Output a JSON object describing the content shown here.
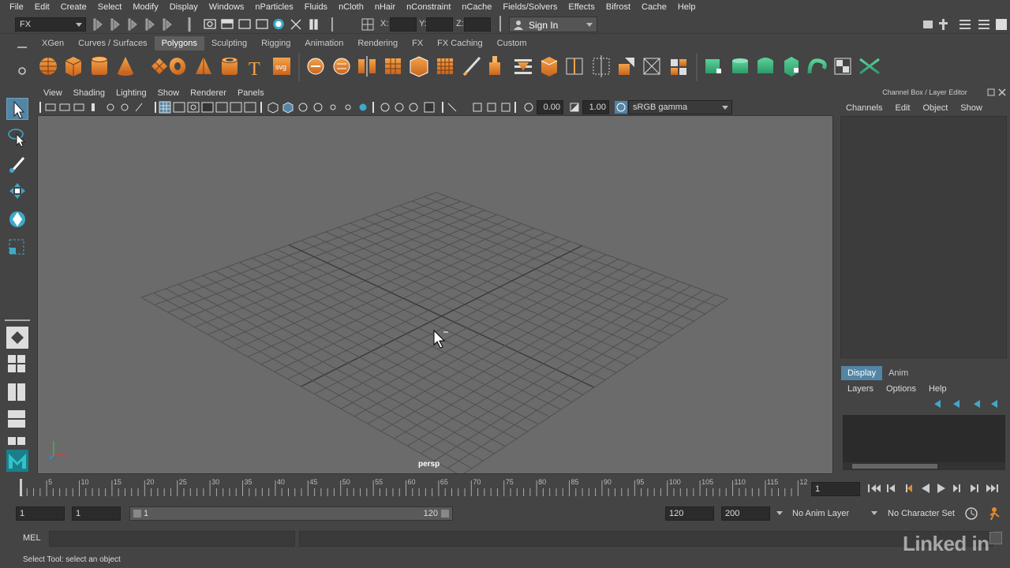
{
  "menubar": {
    "items": [
      "File",
      "Edit",
      "Create",
      "Select",
      "Modify",
      "Display",
      "Windows",
      "nParticles",
      "Fluids",
      "nCloth",
      "nHair",
      "nConstraint",
      "nCache",
      "Fields/Solvers",
      "Effects",
      "Bifrost",
      "Cache",
      "Help"
    ]
  },
  "statusline": {
    "menuset": "FX",
    "x_label": "X:",
    "y_label": "Y:",
    "z_label": "Z:",
    "sign_in": "Sign In"
  },
  "shelf": {
    "tabs": [
      "XGen",
      "Curves / Surfaces",
      "Polygons",
      "Sculpting",
      "Rigging",
      "Animation",
      "Rendering",
      "FX",
      "FX Caching",
      "Custom"
    ],
    "active_tab": "Polygons",
    "text_tool_glyph": "T",
    "svg_tool_label": "svg"
  },
  "viewport": {
    "menus": [
      "View",
      "Shading",
      "Lighting",
      "Show",
      "Renderer",
      "Panels"
    ],
    "exposure": "0.00",
    "gamma": "1.00",
    "color_space": "sRGB gamma",
    "camera_label": "persp"
  },
  "channel_box": {
    "title": "Channel Box / Layer Editor",
    "menus": [
      "Channels",
      "Edit",
      "Object",
      "Show"
    ]
  },
  "layer_editor": {
    "tabs": [
      "Display",
      "Anim"
    ],
    "active_tab": "Display",
    "menus": [
      "Layers",
      "Options",
      "Help"
    ]
  },
  "timeslider": {
    "ticks": [
      "1",
      "5",
      "10",
      "15",
      "20",
      "25",
      "30",
      "35",
      "40",
      "45",
      "50",
      "55",
      "60",
      "65",
      "70",
      "75",
      "80",
      "85",
      "90",
      "95",
      "100",
      "105",
      "110",
      "115",
      "12"
    ],
    "current_frame": "1"
  },
  "range": {
    "start": "1",
    "playback_start": "1",
    "range_start": "1",
    "range_end": "120",
    "playback_end": "120",
    "end": "200",
    "anim_layer": "No Anim Layer",
    "character_set": "No Character Set"
  },
  "cmdline": {
    "label": "MEL"
  },
  "helpline": {
    "text": "Select Tool: select an object"
  },
  "watermark": "Linked in",
  "colors": {
    "accent_blue": "#5285a6",
    "green_shelf": "#3dae7e",
    "orange_shelf": "#e08a2e",
    "viewport_bg": "#6b6b6b"
  }
}
